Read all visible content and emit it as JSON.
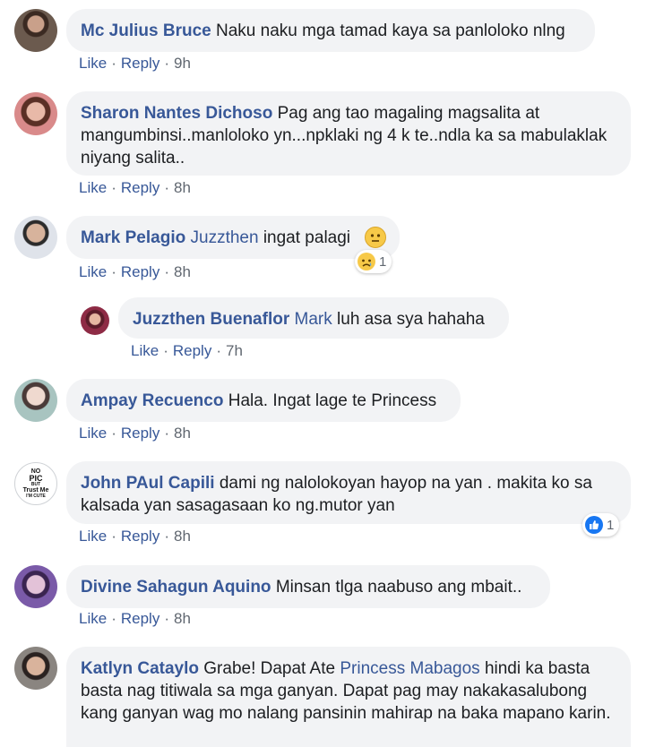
{
  "actions": {
    "like": "Like",
    "reply": "Reply"
  },
  "comments": [
    {
      "author": "Mc Julius Bruce",
      "text": "Naku naku mga tamad kaya sa panloloko nlng",
      "time": "9h"
    },
    {
      "author": "Sharon Nantes Dichoso",
      "text": "Pag ang tao magaling magsalita at mangumbinsi..manloloko yn...npklaki ng 4 k te..ndla ka sa mabulaklak niyang salita..",
      "time": "8h"
    },
    {
      "author": "Mark Pelagio",
      "mention": "Juzzthen",
      "text": "ingat palagi",
      "time": "8h",
      "reaction_icon": "sad-reaction-icon",
      "reaction_count": "1"
    },
    {
      "author": "Juzzthen Buenaflor",
      "mention": "Mark",
      "text": "luh asa sya hahaha",
      "time": "7h"
    },
    {
      "author": "Ampay Recuenco",
      "text": "Hala. Ingat lage te Princess",
      "time": "8h"
    },
    {
      "author": "John PAul Capili",
      "text": "dami ng nalolokoyan hayop na yan . makita ko sa kalsada yan sasagasaan ko ng.mutor yan",
      "time": "8h",
      "reaction_icon": "like-reaction-icon",
      "reaction_count": "1",
      "avatar_text": [
        "NO",
        "PIC",
        "BUT",
        "Trust Me",
        "I'M CUTE"
      ]
    },
    {
      "author": "Divine Sahagun Aquino",
      "text": "Minsan tlga naabuso ang mbait..",
      "time": "8h"
    },
    {
      "author": "Katlyn Cataylo",
      "text_before": "Grabe! Dapat Ate",
      "mention": "Princess Mabagos",
      "text_after": "hindi ka basta basta nag titiwala sa mga ganyan. Dapat pag may nakakasalubong kang ganyan wag mo nalang pansinin mahirap na baka mapano karin."
    }
  ],
  "colors": {
    "link": "#385898",
    "bubble": "#f2f3f5",
    "meta": "#606770",
    "like_blue": "#1877f2"
  }
}
